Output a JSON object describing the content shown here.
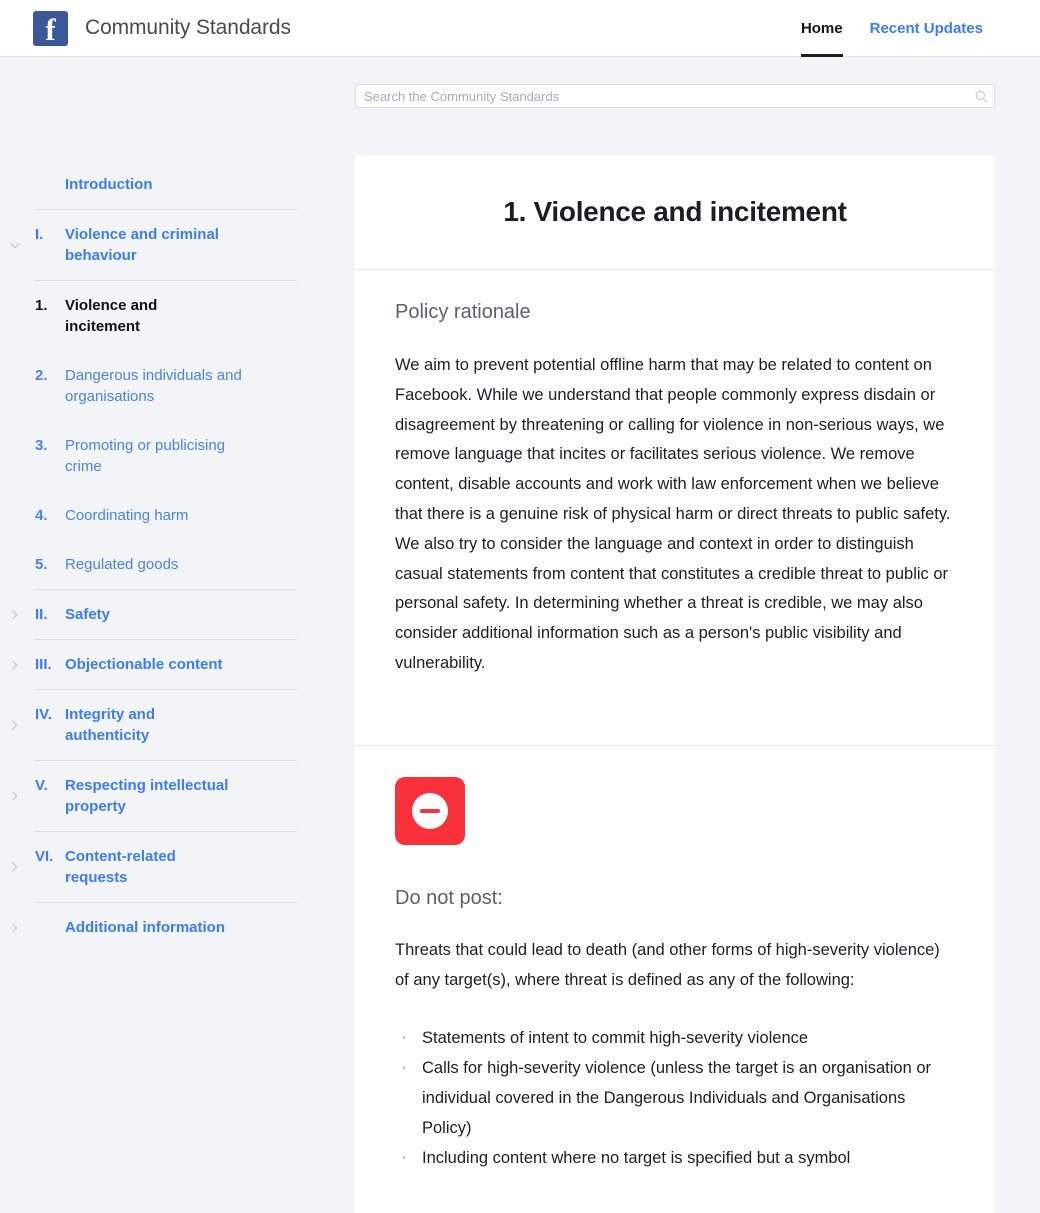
{
  "header": {
    "logo_icon": "facebook-logo-icon",
    "logo_letter": "f",
    "title": "Community Standards",
    "nav": [
      {
        "label": "Home",
        "active": true
      },
      {
        "label": "Recent Updates",
        "active": false
      }
    ]
  },
  "search": {
    "placeholder": "Search the Community Standards",
    "value": "",
    "icon": "search-icon"
  },
  "sidebar": {
    "items": [
      {
        "num": "",
        "label": "Introduction",
        "state": "link",
        "chevron": ""
      },
      {
        "num": "I.",
        "label": "Violence and criminal behaviour",
        "state": "link",
        "chevron": "chevron-down-icon"
      },
      {
        "num": "1.",
        "label": "Violence and incitement",
        "state": "active",
        "chevron": ""
      },
      {
        "num": "2.",
        "label": "Dangerous individuals and organisations",
        "state": "sub",
        "chevron": ""
      },
      {
        "num": "3.",
        "label": "Promoting or publicising crime",
        "state": "sub",
        "chevron": ""
      },
      {
        "num": "4.",
        "label": "Coordinating harm",
        "state": "sub",
        "chevron": ""
      },
      {
        "num": "5.",
        "label": "Regulated goods",
        "state": "sub",
        "chevron": ""
      },
      {
        "num": "II.",
        "label": "Safety",
        "state": "link",
        "chevron": "chevron-right-icon"
      },
      {
        "num": "III.",
        "label": "Objectionable content",
        "state": "link",
        "chevron": "chevron-right-icon"
      },
      {
        "num": "IV.",
        "label": "Integrity and authenticity",
        "state": "link",
        "chevron": "chevron-right-icon"
      },
      {
        "num": "V.",
        "label": "Respecting intellectual property",
        "state": "link",
        "chevron": "chevron-right-icon"
      },
      {
        "num": "VI.",
        "label": "Content-related requests",
        "state": "link",
        "chevron": "chevron-right-icon"
      },
      {
        "num": "",
        "label": "Additional information",
        "state": "link",
        "chevron": "chevron-right-icon"
      }
    ]
  },
  "main": {
    "page_title": "1. Violence and incitement",
    "rationale": {
      "heading": "Policy rationale",
      "text": "We aim to prevent potential offline harm that may be related to content on Facebook. While we understand that people commonly express disdain or disagreement by threatening or calling for violence in non-serious ways, we remove language that incites or facilitates serious violence. We remove content, disable accounts and work with law enforcement when we believe that there is a genuine risk of physical harm or direct threats to public safety. We also try to consider the language and context in order to distinguish casual statements from content that constitutes a credible threat to public or personal safety. In determining whether a threat is credible, we may also consider additional information such as a person's public visibility and vulnerability."
    },
    "do_not_post": {
      "badge_icon": "do-not-post-icon",
      "heading": "Do not post:",
      "intro": "Threats that could lead to death (and other forms of high-severity violence) of any target(s), where threat is defined as any of the following:",
      "bullets": [
        "Statements of intent to commit high-severity violence",
        "Calls for high-severity violence (unless the target is an organisation or individual covered in the Dangerous Individuals and Organisations Policy)",
        "Including content where no target is specified but a symbol"
      ]
    }
  },
  "colors": {
    "brand_blue": "#3b5998",
    "link_blue": "#3b7cf4",
    "danger_red": "#f8313a",
    "page_bg": "#f2f4f7",
    "card_bg": "#ffffff"
  }
}
